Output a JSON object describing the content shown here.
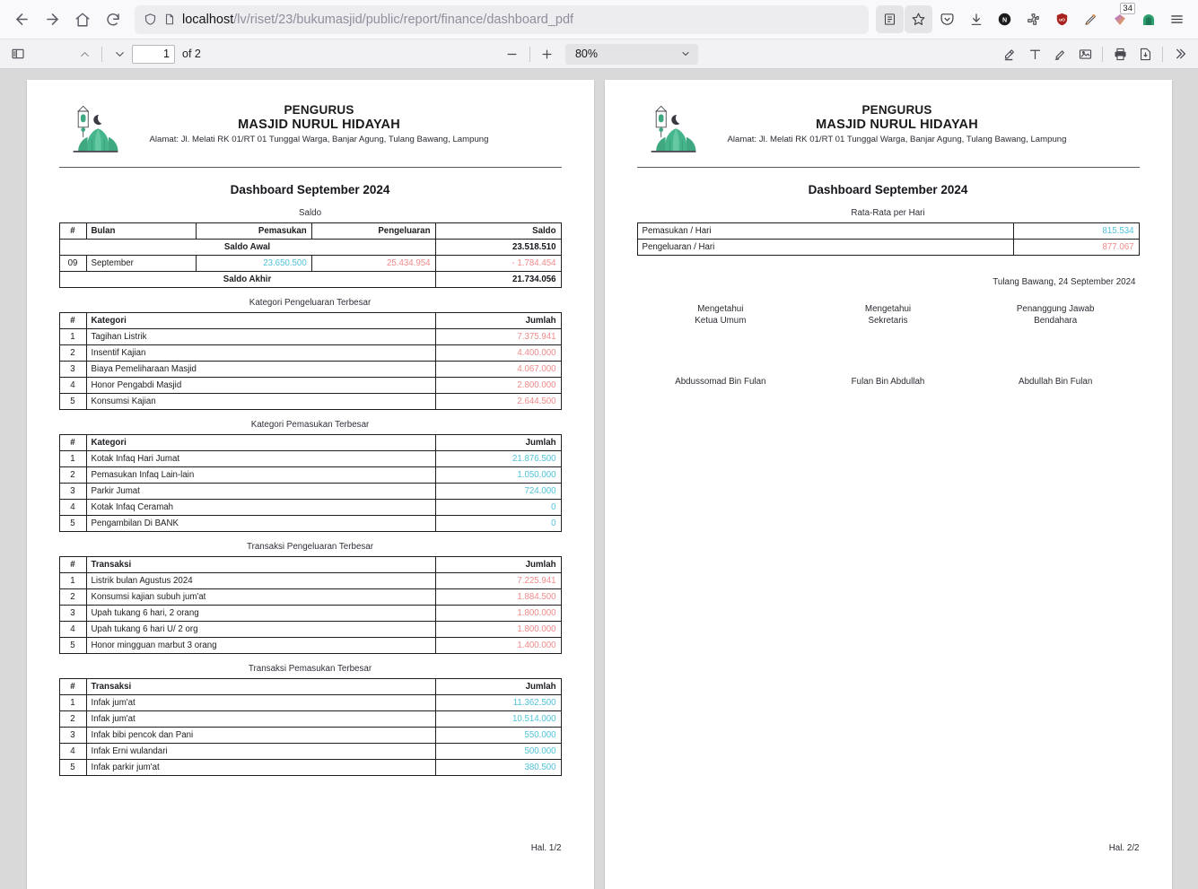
{
  "browser": {
    "url_host": "localhost",
    "url_path": "/lv/riset/23/bukumasjid/public/report/finance/dashboard_pdf",
    "back_icon": "back-arrow-icon",
    "forward_icon": "forward-arrow-icon",
    "home_icon": "home-icon",
    "reload_icon": "reload-icon",
    "shield_icon": "shield-icon",
    "page_icon": "page-icon",
    "toolbar_icons": [
      {
        "name": "reader-view-icon",
        "glyph": "reader"
      },
      {
        "name": "bookmark-star-icon",
        "glyph": "star"
      },
      {
        "name": "pocket-icon",
        "glyph": "pocket"
      },
      {
        "name": "downloads-icon",
        "glyph": "download"
      },
      {
        "name": "notion-extension-icon",
        "glyph": "N"
      },
      {
        "name": "puzzle-extension-icon",
        "glyph": "puzzle"
      },
      {
        "name": "ublock-origin-icon",
        "glyph": "uo"
      },
      {
        "name": "stylus-extension-icon",
        "glyph": "brush"
      },
      {
        "name": "color-picker-extension-icon",
        "glyph": "gem",
        "badge": "34"
      },
      {
        "name": "firefox-account-icon",
        "glyph": "account"
      },
      {
        "name": "app-menu-icon",
        "glyph": "hamburger"
      }
    ]
  },
  "pdf_toolbar": {
    "sidebar_toggle": "sidebar-toggle-icon",
    "prev_page_icon": "chevron-up-icon",
    "next_page_icon": "chevron-down-icon",
    "page_number": "1",
    "page_of": "of 2",
    "zoom_out_icon": "minus-icon",
    "zoom_in_icon": "plus-icon",
    "zoom_level": "80%",
    "tools": [
      {
        "name": "highlight-tool-icon"
      },
      {
        "name": "text-tool-icon"
      },
      {
        "name": "draw-tool-icon"
      },
      {
        "name": "image-tool-icon"
      },
      {
        "name": "print-icon"
      },
      {
        "name": "save-icon"
      },
      {
        "name": "more-tools-icon"
      }
    ]
  },
  "document": {
    "org_line1": "PENGURUS",
    "org_line2": "MASJID NURUL HIDAYAH",
    "org_address": "Alamat: Jl. Melati RK 01/RT 01 Tunggal Warga, Banjar Agung, Tulang Bawang, Lampung",
    "title": "Dashboard September 2024",
    "logo_icon": "mosque-logo-icon"
  },
  "page1": {
    "footer": "Hal. 1/2",
    "saldo": {
      "section_title": "Saldo",
      "headers": [
        "#",
        "Bulan",
        "Pemasukan",
        "Pengeluaran",
        "Saldo"
      ],
      "saldo_awal_label": "Saldo Awal",
      "saldo_awal_value": "23.518.510",
      "row": {
        "no": "09",
        "bulan": "September",
        "pemasukan": "23.650.500",
        "pengeluaran": "25.434.954",
        "saldo": "- 1.784.454"
      },
      "saldo_akhir_label": "Saldo Akhir",
      "saldo_akhir_value": "21.734.056"
    },
    "kategori_pengeluaran": {
      "section_title": "Kategori Pengeluaran Terbesar",
      "headers": [
        "#",
        "Kategori",
        "Jumlah"
      ],
      "rows": [
        {
          "no": "1",
          "label": "Tagihan Listrik",
          "amount": "7.375.941"
        },
        {
          "no": "2",
          "label": "Insentif Kajian",
          "amount": "4.400.000"
        },
        {
          "no": "3",
          "label": "Biaya Pemeliharaan Masjid",
          "amount": "4.067.000"
        },
        {
          "no": "4",
          "label": "Honor Pengabdi Masjid",
          "amount": "2.800.000"
        },
        {
          "no": "5",
          "label": "Konsumsi Kajian",
          "amount": "2.644.500"
        }
      ]
    },
    "kategori_pemasukan": {
      "section_title": "Kategori Pemasukan Terbesar",
      "headers": [
        "#",
        "Kategori",
        "Jumlah"
      ],
      "rows": [
        {
          "no": "1",
          "label": "Kotak Infaq Hari Jumat",
          "amount": "21.876.500"
        },
        {
          "no": "2",
          "label": "Pemasukan Infaq Lain-lain",
          "amount": "1.050.000"
        },
        {
          "no": "3",
          "label": "Parkir Jumat",
          "amount": "724.000"
        },
        {
          "no": "4",
          "label": "Kotak Infaq Ceramah",
          "amount": "0"
        },
        {
          "no": "5",
          "label": "Pengambilan Di BANK",
          "amount": "0"
        }
      ]
    },
    "transaksi_pengeluaran": {
      "section_title": "Transaksi Pengeluaran Terbesar",
      "headers": [
        "#",
        "Transaksi",
        "Jumlah"
      ],
      "rows": [
        {
          "no": "1",
          "label": "Listrik bulan Agustus 2024",
          "amount": "7.225.941"
        },
        {
          "no": "2",
          "label": "Konsumsi kajian subuh jum'at",
          "amount": "1.884.500"
        },
        {
          "no": "3",
          "label": "Upah tukang 6 hari, 2 orang",
          "amount": "1.800.000"
        },
        {
          "no": "4",
          "label": "Upah tukang 6 hari U/ 2 org",
          "amount": "1.800.000"
        },
        {
          "no": "5",
          "label": "Honor mingguan marbut 3 orang",
          "amount": "1.400.000"
        }
      ]
    },
    "transaksi_pemasukan": {
      "section_title": "Transaksi Pemasukan Terbesar",
      "headers": [
        "#",
        "Transaksi",
        "Jumlah"
      ],
      "rows": [
        {
          "no": "1",
          "label": "Infak jum'at",
          "amount": "11.362.500"
        },
        {
          "no": "2",
          "label": "Infak jum'at",
          "amount": "10.514.000"
        },
        {
          "no": "3",
          "label": "Infak bibi pencok dan Pani",
          "amount": "550.000"
        },
        {
          "no": "4",
          "label": "Infak Erni wulandari",
          "amount": "500.000"
        },
        {
          "no": "5",
          "label": "Infak parkir jum'at",
          "amount": "380.500"
        }
      ]
    }
  },
  "page2": {
    "footer": "Hal. 2/2",
    "rata_rata": {
      "section_title": "Rata-Rata per Hari",
      "rows": [
        {
          "label": "Pemasukan / Hari",
          "amount": "815.534",
          "kind": "in"
        },
        {
          "label": "Pengeluaran / Hari",
          "amount": "877.067",
          "kind": "out"
        }
      ]
    },
    "date_line": "Tulang Bawang, 24 September 2024",
    "signatures": [
      {
        "role1": "Mengetahui",
        "role2": "Ketua Umum",
        "name": "Abdussomad Bin Fulan"
      },
      {
        "role1": "Mengetahui",
        "role2": "Sekretaris",
        "name": "Fulan Bin Abdullah"
      },
      {
        "role1": "Penanggung Jawab",
        "role2": "Bendahara",
        "name": "Abdullah Bin Fulan"
      }
    ]
  },
  "colors": {
    "income": "#4fc3d9",
    "expense": "#f08a8a",
    "logo_green": "#3fa880"
  }
}
